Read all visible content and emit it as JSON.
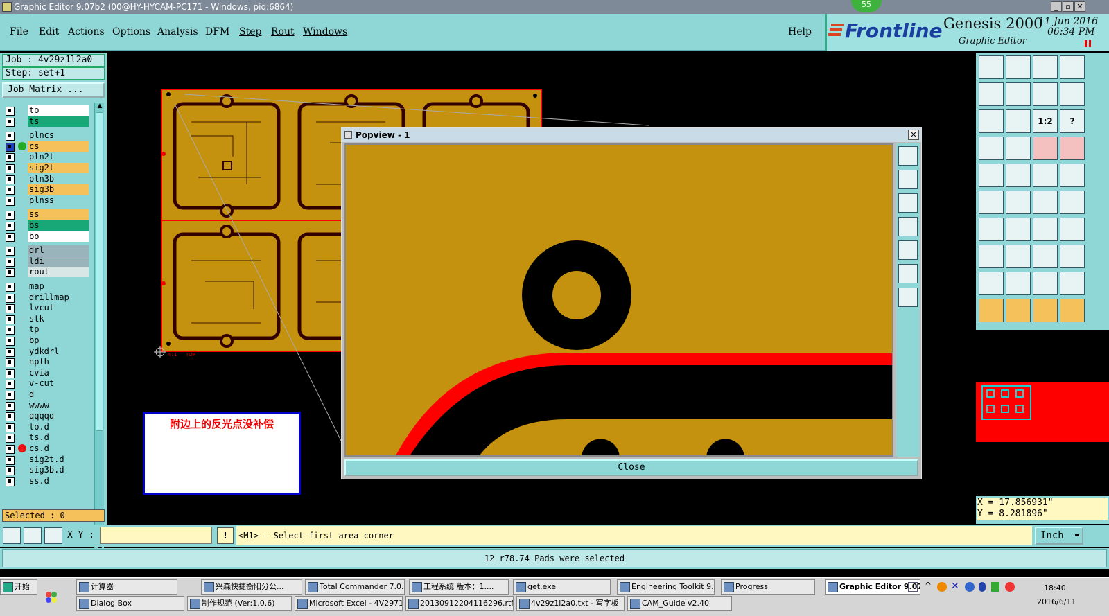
{
  "window": {
    "title": "Graphic Editor 9.07b2 (00@HY-HYCAM-PC171 - Windows, pid:6864)",
    "badge": "55"
  },
  "menu": {
    "file": "File",
    "edit": "Edit",
    "actions": "Actions",
    "options": "Options",
    "analysis": "Analysis",
    "dfm": "DFM",
    "step": "Step",
    "rout": "Rout",
    "windows": "Windows",
    "help": "Help"
  },
  "brand": {
    "logo": "Frontline",
    "product": "Genesis 2000",
    "subtitle": "Graphic Editor",
    "date": "11 Jun 2016",
    "time": "06:34 PM"
  },
  "left": {
    "job": "Job : 4v29z1l2a0",
    "step": "Step: set+1",
    "job_matrix": "Job Matrix ...",
    "selected": "Selected : 0",
    "layers": [
      {
        "name": "to",
        "color": "#ffffff"
      },
      {
        "name": "ts",
        "color": "#18a878"
      },
      {
        "name": "plncs",
        "color": "#8fd6d6"
      },
      {
        "name": "cs",
        "color": "#f5c15a"
      },
      {
        "name": "pln2t",
        "color": "#8fd6d6"
      },
      {
        "name": "sig2t",
        "color": "#f5c15a"
      },
      {
        "name": "pln3b",
        "color": "#8fd6d6"
      },
      {
        "name": "sig3b",
        "color": "#f5c15a"
      },
      {
        "name": "plnss",
        "color": "#8fd6d6"
      },
      {
        "name": "ss",
        "color": "#f5c15a"
      },
      {
        "name": "bs",
        "color": "#18a878"
      },
      {
        "name": "bo",
        "color": "#ffffff"
      },
      {
        "name": "drl",
        "color": "#9ab4bc"
      },
      {
        "name": "ldi",
        "color": "#9ab4bc"
      },
      {
        "name": "rout",
        "color": "#d8e6e6"
      },
      {
        "name": "map",
        "color": "#8fd6d6"
      },
      {
        "name": "drillmap",
        "color": "#8fd6d6"
      },
      {
        "name": "lvcut",
        "color": "#8fd6d6"
      },
      {
        "name": "stk",
        "color": "#8fd6d6"
      },
      {
        "name": "tp",
        "color": "#8fd6d6"
      },
      {
        "name": "bp",
        "color": "#8fd6d6"
      },
      {
        "name": "ydkdrl",
        "color": "#8fd6d6"
      },
      {
        "name": "npth",
        "color": "#8fd6d6"
      },
      {
        "name": "cvia",
        "color": "#8fd6d6"
      },
      {
        "name": "v-cut",
        "color": "#8fd6d6"
      },
      {
        "name": "d",
        "color": "#8fd6d6"
      },
      {
        "name": "wwww",
        "color": "#8fd6d6"
      },
      {
        "name": "qqqqq",
        "color": "#8fd6d6"
      },
      {
        "name": "to.d",
        "color": "#8fd6d6"
      },
      {
        "name": "ts.d",
        "color": "#8fd6d6"
      },
      {
        "name": "cs.d",
        "color": "#8fd6d6"
      },
      {
        "name": "sig2t.d",
        "color": "#8fd6d6"
      },
      {
        "name": "sig3b.d",
        "color": "#8fd6d6"
      },
      {
        "name": "ss.d",
        "color": "#8fd6d6"
      }
    ]
  },
  "canvas": {
    "note": "附边上的反光点没补偿",
    "origin_label": "471",
    "origin_label2": "TOP"
  },
  "popview": {
    "title": "Popview - 1",
    "close_label": "Close"
  },
  "right": {
    "scale_label": "1:2",
    "help_label": "?",
    "coord_x": "X = 17.856931\"",
    "coord_y": "Y = 8.281896\""
  },
  "cmd": {
    "xy_label": "X Y :",
    "xy_value": "",
    "prompt": "<M1> - Select first area corner",
    "units": "Inch"
  },
  "status": {
    "message": "12 r78.74 Pads were selected"
  },
  "taskbar": {
    "start": "开始",
    "clock_time": "18:40",
    "clock_date": "2016/6/11",
    "row1": [
      {
        "label": "计算器"
      },
      {
        "label": "兴森快捷衡阳分公..."
      },
      {
        "label": "Total Commander 7.0..."
      },
      {
        "label": "工程系统  版本：1...."
      },
      {
        "label": "get.exe"
      },
      {
        "label": "Engineering Toolkit 9...."
      },
      {
        "label": "Progress"
      },
      {
        "label": "Graphic Editor 9.07..."
      }
    ],
    "row2": [
      {
        "label": "Dialog Box"
      },
      {
        "label": "制作规范 (Ver:1.0.6)"
      },
      {
        "label": "Microsoft Excel - 4V2971..."
      },
      {
        "label": "20130912204116296.rtf..."
      },
      {
        "label": "4v29z1l2a0.txt - 写字板"
      },
      {
        "label": "CAM_Guide v2.40"
      }
    ]
  },
  "colors": {
    "panel": "#8fd6d6",
    "board": "#c4920e",
    "red": "#ff0000"
  }
}
